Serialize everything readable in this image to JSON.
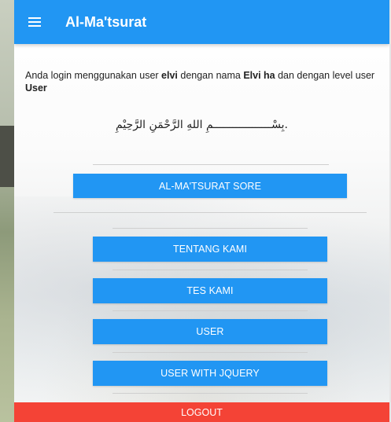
{
  "header": {
    "title": "Al-Ma'tsurat",
    "menu_icon": "hamburger-menu-icon"
  },
  "login_info": {
    "prefix": "Anda login menggunakan user ",
    "username": "elvi",
    "middle1": " dengan nama ",
    "fullname": "Elvi ha",
    "middle2": " dan dengan level user ",
    "level": "User"
  },
  "basmalah": ".بِسْــــــــــــــــــمِ اللهِ الرَّحْمَنِ الرَّحِيْمِ",
  "buttons": {
    "sore": "AL-MA'TSURAT SORE",
    "tentang": "TENTANG KAMI",
    "tes": "TES KAMI",
    "user": "USER",
    "user_jquery": "USER WITH JQUERY",
    "logout": "LOGOUT"
  },
  "colors": {
    "primary": "#2196f3",
    "danger": "#f44336"
  }
}
